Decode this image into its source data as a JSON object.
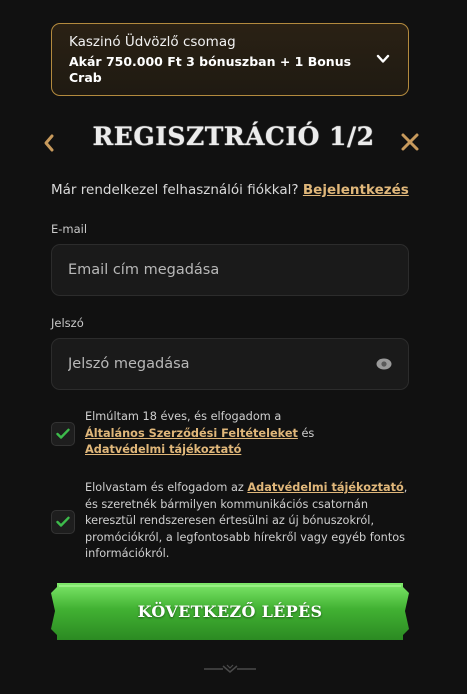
{
  "promo": {
    "title": "Kaszinó Üdvözlő csomag",
    "offer": "Akár 750.000 Ft 3 bónuszban + 1 Bonus Crab"
  },
  "header": {
    "title": "REGISZTRÁCIÓ 1/2"
  },
  "login": {
    "prompt": "Már rendelkezel felhasználói fiókkal?",
    "link": "Bejelentkezés"
  },
  "email": {
    "label": "E-mail",
    "placeholder": "Email cím megadása"
  },
  "password": {
    "label": "Jelszó",
    "placeholder": "Jelszó megadása"
  },
  "consent1": {
    "text_before": "Elmúltam 18 éves, és elfogadom a",
    "link1": "Általános Szerződési Feltételeket",
    "text_middle": " és",
    "link2": "Adatvédelmi tájékoztató"
  },
  "consent2": {
    "text_before": "Elolvastam és elfogadom az ",
    "link": "Adatvédelmi tájékoztató",
    "text_after": ", és szeretnék bármilyen kommunikációs csatornán keresztül rendszeresen értesülni az új bónuszokról, promóciókról, a legfontosabb hírekről vagy egyéb fontos információkról."
  },
  "next_button": {
    "label": "KÖVETKEZŐ LÉPÉS"
  },
  "colors": {
    "accent_gold": "#e0b77a",
    "promo_border": "#b38a3e",
    "button_green": "#3da32f",
    "check_green": "#3dbb4b",
    "background": "#111111"
  }
}
